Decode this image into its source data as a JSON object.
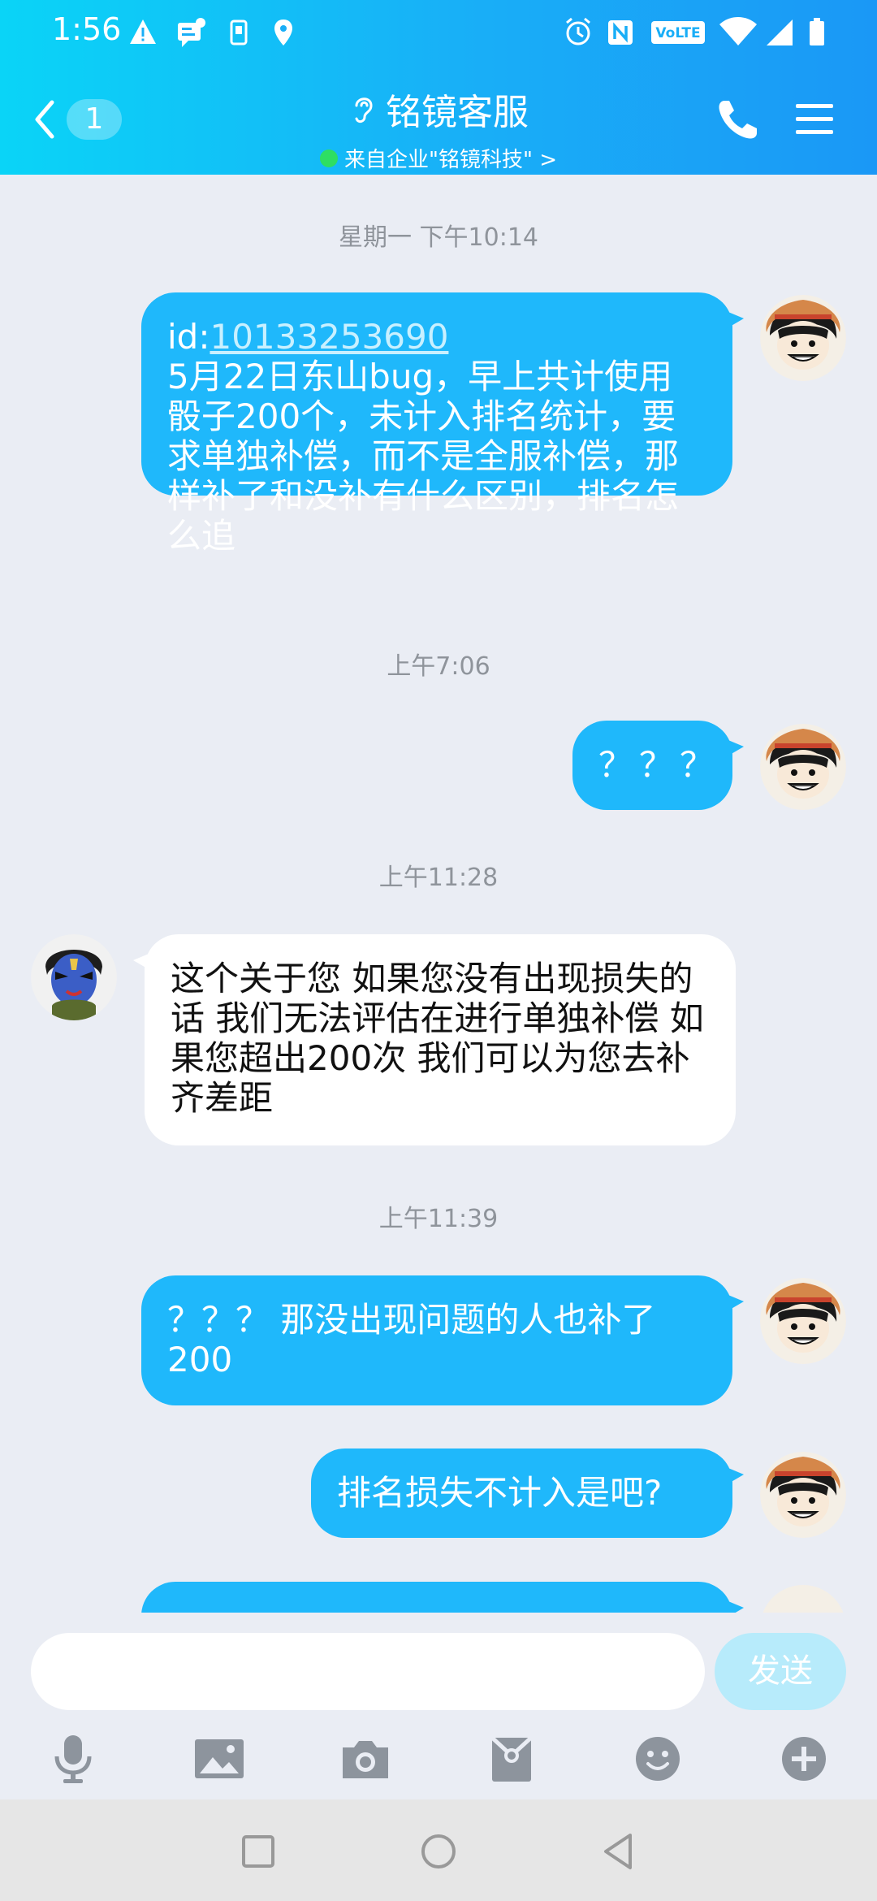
{
  "status_bar": {
    "time": "1:56"
  },
  "header": {
    "back_badge": "1",
    "title": "铭镜客服",
    "subtitle": "来自企业\"铭镜科技\" >"
  },
  "messages": [
    {
      "type": "timestamp",
      "text": "星期一 下午10:14"
    },
    {
      "type": "sent",
      "link": "10133253690",
      "prefix": "id:",
      "text": "5月22日东山bug，早上共计使用骰子200个，未计入排名统计，要求单独补偿，而不是全服补偿，那样补了和没补有什么区别，排名怎么追"
    },
    {
      "type": "timestamp",
      "text": "上午7:06"
    },
    {
      "type": "sent",
      "text": "？？？"
    },
    {
      "type": "timestamp",
      "text": "上午11:28"
    },
    {
      "type": "received",
      "text": "这个关于您 如果您没有出现损失的话 我们无法评估在进行单独补偿 如果您超出200次 我们可以为您去补齐差距"
    },
    {
      "type": "timestamp",
      "text": "上午11:39"
    },
    {
      "type": "sent",
      "text": "？？？ 那没出现问题的人也补了200"
    },
    {
      "type": "sent",
      "text": "排名损失不计入是吧?"
    }
  ],
  "input": {
    "placeholder": "",
    "send_label": "发送"
  },
  "toolbar": [
    "microphone-icon",
    "image-icon",
    "camera-icon",
    "red-packet-icon",
    "emoji-icon",
    "plus-icon"
  ],
  "colors": {
    "header_start": "#0ad4f7",
    "header_end": "#1a98f6",
    "sent_bubble": "#1fb8fb",
    "background": "#eaedf4"
  }
}
